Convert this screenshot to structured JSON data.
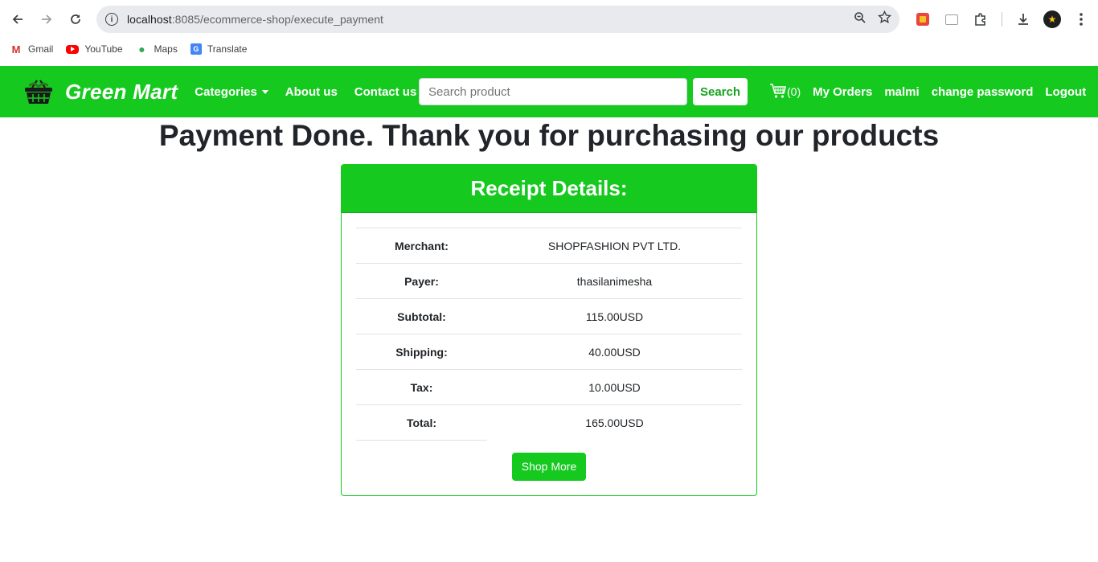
{
  "browser": {
    "url_host": "localhost",
    "url_path": ":8085/ecommerce-shop/execute_payment",
    "bookmarks": [
      {
        "label": "Gmail",
        "icon": "gmail-icon"
      },
      {
        "label": "YouTube",
        "icon": "youtube-icon"
      },
      {
        "label": "Maps",
        "icon": "maps-icon"
      },
      {
        "label": "Translate",
        "icon": "translate-icon"
      }
    ]
  },
  "navbar": {
    "brand": "Green Mart",
    "categories": "Categories",
    "about": "About us",
    "contact": "Contact us",
    "search_placeholder": "Search product",
    "search_button": "Search",
    "cart_count": "(0)",
    "my_orders": "My Orders",
    "username": "malmi",
    "change_password": "change password",
    "logout": "Logout",
    "color": "#16c91f"
  },
  "main": {
    "heading": "Payment Done. Thank you for purchasing our products",
    "receipt_title": "Receipt Details:",
    "rows": [
      {
        "key": "Merchant:",
        "value": "SHOPFASHION PVT LTD."
      },
      {
        "key": "Payer:",
        "value": "thasilanimesha"
      },
      {
        "key": "Subtotal:",
        "value": "115.00USD"
      },
      {
        "key": "Shipping:",
        "value": "40.00USD"
      },
      {
        "key": "Tax:",
        "value": "10.00USD"
      },
      {
        "key": "Total:",
        "value": "165.00USD"
      }
    ],
    "shop_more": "Shop More"
  }
}
